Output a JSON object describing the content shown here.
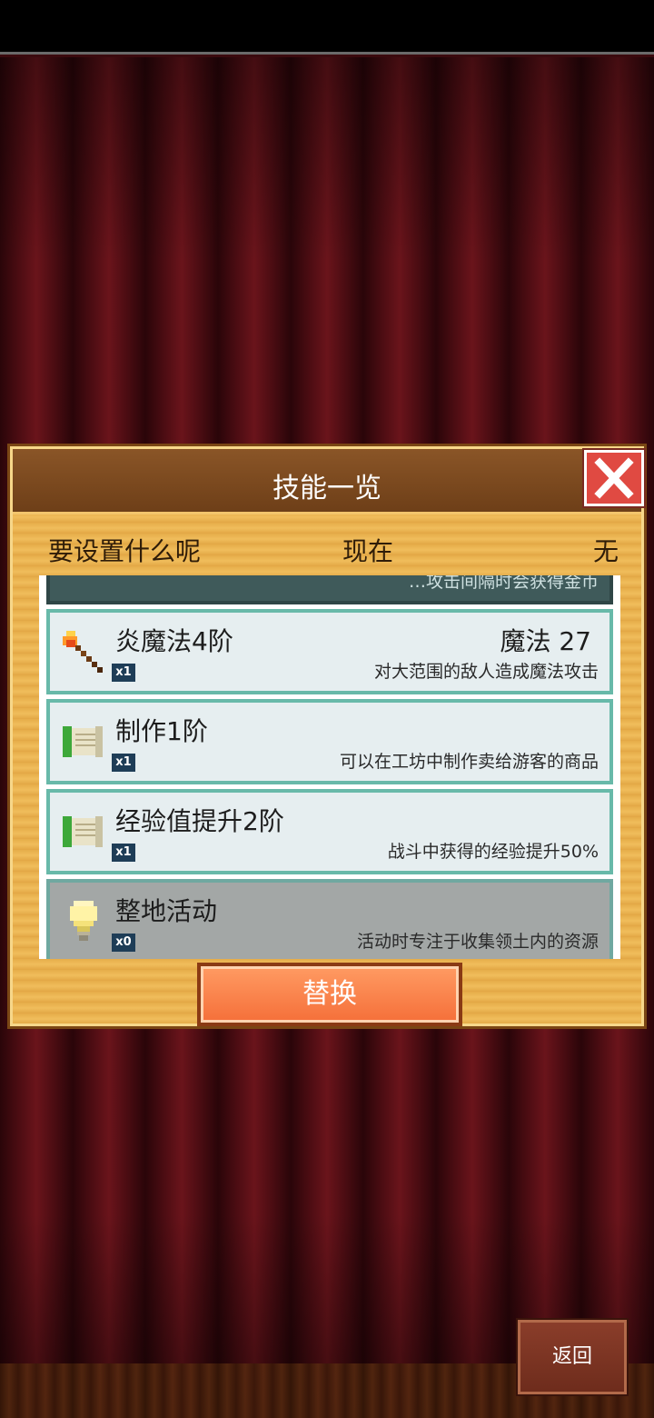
{
  "dialog": {
    "title": "技能一览",
    "subheader": {
      "question": "要设置什么呢",
      "now_label": "现在",
      "now_value": "无"
    },
    "skills": [
      {
        "name": "",
        "stat": "",
        "level_badge": "",
        "description": "…攻击间隔时会获得金币",
        "icon": "none",
        "state": "partial"
      },
      {
        "name": "炎魔法4阶",
        "stat": "魔法 27",
        "level_badge": "x1",
        "description": "对大范围的敌人造成魔法攻击",
        "icon": "fire-staff-icon",
        "state": "normal"
      },
      {
        "name": "制作1阶",
        "stat": "",
        "level_badge": "x1",
        "description": "可以在工坊中制作卖给游客的商品",
        "icon": "scroll-icon",
        "state": "normal"
      },
      {
        "name": "经验值提升2阶",
        "stat": "",
        "level_badge": "x1",
        "description": "战斗中获得的经验提升50%",
        "icon": "scroll-icon",
        "state": "normal"
      },
      {
        "name": "整地活动",
        "stat": "",
        "level_badge": "x0",
        "description": "活动时专注于收集领土内的资源",
        "icon": "lightbulb-icon",
        "state": "disabled"
      }
    ],
    "replace_label": "替换"
  },
  "back_label": "返回",
  "colors": {
    "curtain": "#4e0d13",
    "panel": "#e6ad4a",
    "header": "#7a4614",
    "item_border": "#68b9a9",
    "replace_button": "#f56f39",
    "close_button": "#e04a42"
  }
}
